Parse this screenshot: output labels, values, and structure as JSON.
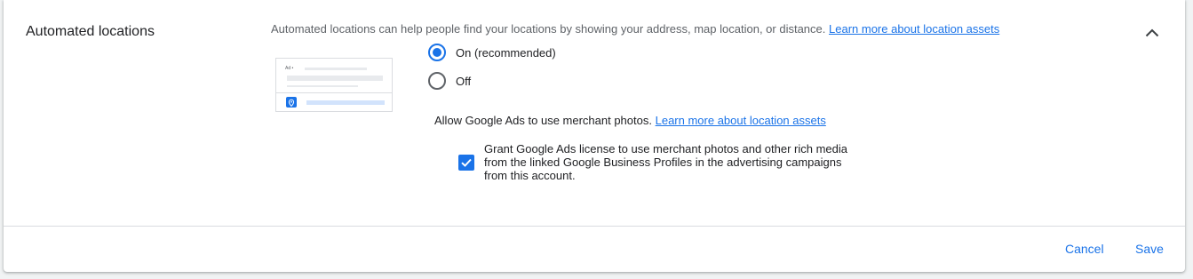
{
  "section": {
    "title": "Automated locations",
    "description": "Automated locations can help people find your locations by showing your address, map location, or distance.",
    "learn_more_link": "Learn more about location assets",
    "collapse_icon": "chevron-up-icon"
  },
  "preview": {
    "ad_label": "Ad •",
    "pin_icon": "location-pin-icon"
  },
  "options": {
    "on_label": "On (recommended)",
    "off_label": "Off",
    "selected": "on"
  },
  "merchant": {
    "text": "Allow Google Ads to use merchant photos.",
    "learn_more_link": "Learn more about location assets",
    "checkbox_checked": true,
    "checkbox_label": "Grant Google Ads license to use merchant photos and other rich media from the linked Google Business Profiles in the advertising campaigns from this account."
  },
  "footer": {
    "cancel_label": "Cancel",
    "save_label": "Save"
  },
  "colors": {
    "accent": "#1a73e8",
    "text": "#202124",
    "secondary_text": "#5f6368"
  }
}
